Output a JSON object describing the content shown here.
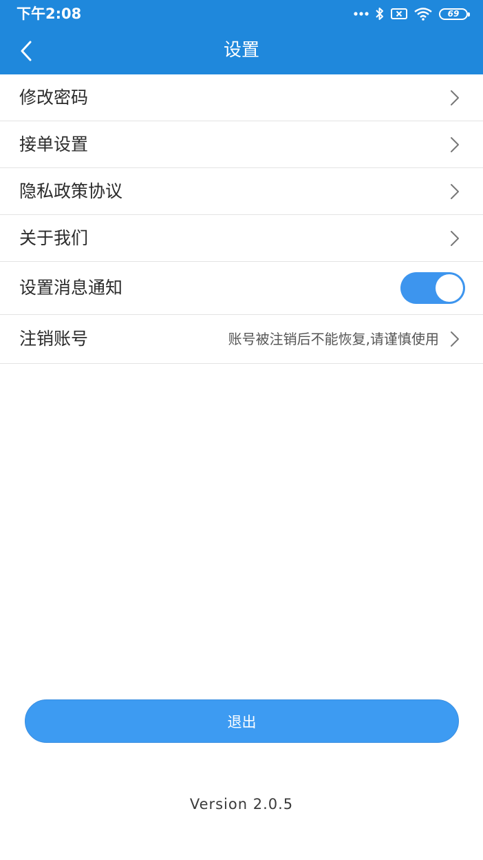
{
  "status_bar": {
    "time": "下午2:08",
    "battery": "69",
    "icons": [
      "more-dots-icon",
      "bluetooth-icon",
      "sim-x-icon",
      "wifi-icon",
      "battery-icon"
    ]
  },
  "header": {
    "title": "设置",
    "background": "#1f88dc",
    "back_icon": "chevron-left-icon"
  },
  "settings": {
    "items": [
      {
        "label": "修改密码",
        "type": "link"
      },
      {
        "label": "接单设置",
        "type": "link"
      },
      {
        "label": "隐私政策协议",
        "type": "link"
      },
      {
        "label": "关于我们",
        "type": "link"
      },
      {
        "label": "设置消息通知",
        "type": "toggle",
        "enabled": true
      },
      {
        "label": "注销账号",
        "type": "link",
        "hint": "账号被注销后不能恢复,请谨慎使用"
      }
    ]
  },
  "logout": {
    "label": "退出",
    "color": "#3d9bf2"
  },
  "footer": {
    "version": "Version  2.0.5"
  }
}
